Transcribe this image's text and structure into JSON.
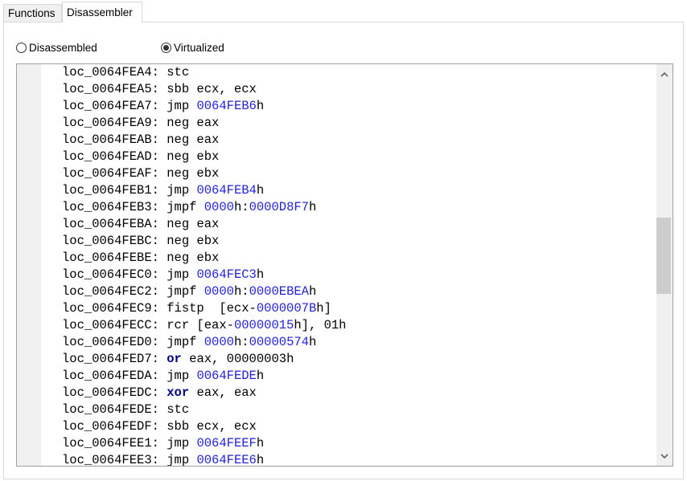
{
  "tabs": [
    {
      "label": "Functions",
      "active": false
    },
    {
      "label": "Disassembler",
      "active": true
    }
  ],
  "view_mode": {
    "options": [
      {
        "label": "Disassembled",
        "checked": false
      },
      {
        "label": "Virtualized",
        "checked": true
      }
    ]
  },
  "colors": {
    "number": "#2323d8",
    "keyword": "#000080"
  },
  "listing": [
    {
      "label": "loc_0064FEA4:",
      "parts": [
        {
          "t": " stc"
        }
      ]
    },
    {
      "label": "loc_0064FEA5:",
      "parts": [
        {
          "t": " sbb ecx, ecx"
        }
      ]
    },
    {
      "label": "loc_0064FEA7:",
      "parts": [
        {
          "t": " jmp "
        },
        {
          "t": "0064FEB6",
          "c": "num"
        },
        {
          "t": "h"
        }
      ]
    },
    {
      "label": "loc_0064FEA9:",
      "parts": [
        {
          "t": " neg eax"
        }
      ]
    },
    {
      "label": "loc_0064FEAB:",
      "parts": [
        {
          "t": " neg eax"
        }
      ]
    },
    {
      "label": "loc_0064FEAD:",
      "parts": [
        {
          "t": " neg ebx"
        }
      ]
    },
    {
      "label": "loc_0064FEAF:",
      "parts": [
        {
          "t": " neg ebx"
        }
      ]
    },
    {
      "label": "loc_0064FEB1:",
      "parts": [
        {
          "t": " jmp "
        },
        {
          "t": "0064FEB4",
          "c": "num"
        },
        {
          "t": "h"
        }
      ]
    },
    {
      "label": "loc_0064FEB3:",
      "parts": [
        {
          "t": " jmpf "
        },
        {
          "t": "0000",
          "c": "num"
        },
        {
          "t": "h:"
        },
        {
          "t": "0000D8F7",
          "c": "num"
        },
        {
          "t": "h"
        }
      ]
    },
    {
      "label": "loc_0064FEBA:",
      "parts": [
        {
          "t": " neg eax"
        }
      ]
    },
    {
      "label": "loc_0064FEBC:",
      "parts": [
        {
          "t": " neg ebx"
        }
      ]
    },
    {
      "label": "loc_0064FEBE:",
      "parts": [
        {
          "t": " neg ebx"
        }
      ]
    },
    {
      "label": "loc_0064FEC0:",
      "parts": [
        {
          "t": " jmp "
        },
        {
          "t": "0064FEC3",
          "c": "num"
        },
        {
          "t": "h"
        }
      ]
    },
    {
      "label": "loc_0064FEC2:",
      "parts": [
        {
          "t": " jmpf "
        },
        {
          "t": "0000",
          "c": "num"
        },
        {
          "t": "h:"
        },
        {
          "t": "0000EBEA",
          "c": "num"
        },
        {
          "t": "h"
        }
      ]
    },
    {
      "label": "loc_0064FEC9:",
      "parts": [
        {
          "t": " fistp  [ecx-"
        },
        {
          "t": "0000007B",
          "c": "num"
        },
        {
          "t": "h]"
        }
      ]
    },
    {
      "label": "loc_0064FECC:",
      "parts": [
        {
          "t": " rcr [eax-"
        },
        {
          "t": "00000015",
          "c": "num"
        },
        {
          "t": "h], 01h"
        }
      ]
    },
    {
      "label": "loc_0064FED0:",
      "parts": [
        {
          "t": " jmpf "
        },
        {
          "t": "0000",
          "c": "num"
        },
        {
          "t": "h:"
        },
        {
          "t": "00000574",
          "c": "num"
        },
        {
          "t": "h"
        }
      ]
    },
    {
      "label": "loc_0064FED7:",
      "parts": [
        {
          "t": " "
        },
        {
          "t": "or",
          "c": "kw"
        },
        {
          "t": " eax, 00000003h"
        }
      ]
    },
    {
      "label": "loc_0064FEDA:",
      "parts": [
        {
          "t": " jmp "
        },
        {
          "t": "0064FEDE",
          "c": "num"
        },
        {
          "t": "h"
        }
      ]
    },
    {
      "label": "loc_0064FEDC:",
      "parts": [
        {
          "t": " "
        },
        {
          "t": "xor",
          "c": "kw"
        },
        {
          "t": " eax, eax"
        }
      ]
    },
    {
      "label": "loc_0064FEDE:",
      "parts": [
        {
          "t": " stc"
        }
      ]
    },
    {
      "label": "loc_0064FEDF:",
      "parts": [
        {
          "t": " sbb ecx, ecx"
        }
      ]
    },
    {
      "label": "loc_0064FEE1:",
      "parts": [
        {
          "t": " jmp "
        },
        {
          "t": "0064FEEF",
          "c": "num"
        },
        {
          "t": "h"
        }
      ]
    },
    {
      "label": "loc_0064FEE3:",
      "parts": [
        {
          "t": " jmp "
        },
        {
          "t": "0064FEE6",
          "c": "num"
        },
        {
          "t": "h"
        }
      ]
    }
  ],
  "scrollbar": {
    "up_icon": "chevron-up-icon",
    "down_icon": "chevron-down-icon"
  }
}
